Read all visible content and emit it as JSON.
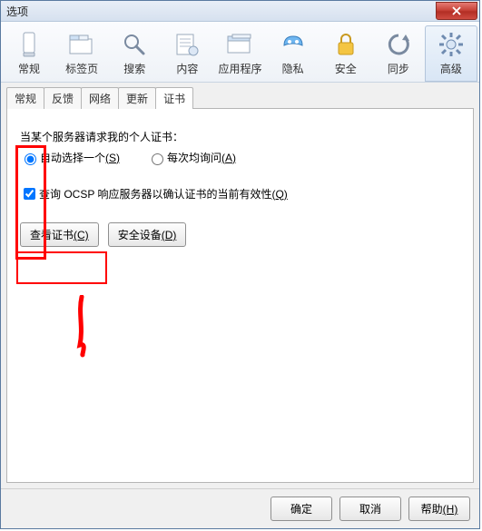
{
  "window": {
    "title": "选项"
  },
  "toolbar": [
    {
      "label": "常规"
    },
    {
      "label": "标签页"
    },
    {
      "label": "搜索"
    },
    {
      "label": "内容"
    },
    {
      "label": "应用程序"
    },
    {
      "label": "隐私"
    },
    {
      "label": "安全"
    },
    {
      "label": "同步"
    },
    {
      "label": "高级"
    }
  ],
  "subtabs": [
    {
      "label": "常规"
    },
    {
      "label": "反馈"
    },
    {
      "label": "网络"
    },
    {
      "label": "更新"
    },
    {
      "label": "证书"
    }
  ],
  "panel": {
    "prompt": "当某个服务器请求我的个人证书：",
    "radio_auto": "自动选择一个",
    "radio_auto_key": "(S)",
    "radio_ask": "每次均询问",
    "radio_ask_key": "(A)",
    "ocsp": "查询 OCSP 响应服务器以确认证书的当前有效性",
    "ocsp_key": "(Q)",
    "btn_view": "查看证书",
    "btn_view_key": "(C)",
    "btn_devices": "安全设备",
    "btn_devices_key": "(D)"
  },
  "footer": {
    "ok": "确定",
    "cancel": "取消",
    "help": "帮助",
    "help_key": "(H)"
  }
}
